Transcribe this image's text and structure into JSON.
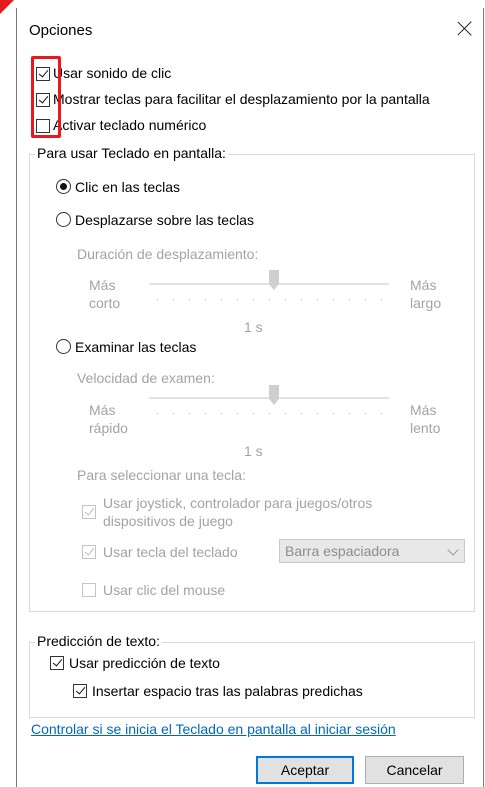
{
  "window": {
    "title": "Opciones"
  },
  "options": [
    {
      "label": "Usar sonido de clic",
      "checked": true
    },
    {
      "label": "Mostrar teclas para facilitar el desplazamiento por la pantalla",
      "checked": true
    },
    {
      "label": "Activar teclado numérico",
      "checked": false
    }
  ],
  "onscreen": {
    "group_label": "Para usar Teclado en pantalla:",
    "click_keys": "Clic en las teclas",
    "hover_keys": "Desplazarse sobre las teclas",
    "hover_duration": {
      "label": "Duración de desplazamiento:",
      "left_1": "Más",
      "left_2": "corto",
      "right_1": "Más",
      "right_2": "largo",
      "value": "1 s"
    },
    "scan_keys": "Examinar las teclas",
    "scan_speed": {
      "label": "Velocidad de examen:",
      "left_1": "Más",
      "left_2": "rápido",
      "right_1": "Más",
      "right_2": "lento",
      "value": "1 s"
    },
    "select_key_label": "Para seleccionar una tecla:",
    "joystick_1": "Usar joystick, controlador para juegos/otros",
    "joystick_2": "dispositivos de juego",
    "keyboard_key": "Usar tecla del teclado",
    "keyboard_key_value": "Barra espaciadora",
    "mouse_click": "Usar clic del mouse"
  },
  "prediction": {
    "group_label": "Predicción de texto:",
    "use": "Usar predicción de texto",
    "insert_space": "Insertar espacio tras las palabras predichas"
  },
  "link": "Controlar si se inicia el Teclado en pantalla al iniciar sesión",
  "buttons": {
    "ok": "Aceptar",
    "cancel": "Cancelar"
  },
  "colors": {
    "highlight": "#e8191d",
    "link": "#0067c0",
    "focus": "#0078d7"
  }
}
